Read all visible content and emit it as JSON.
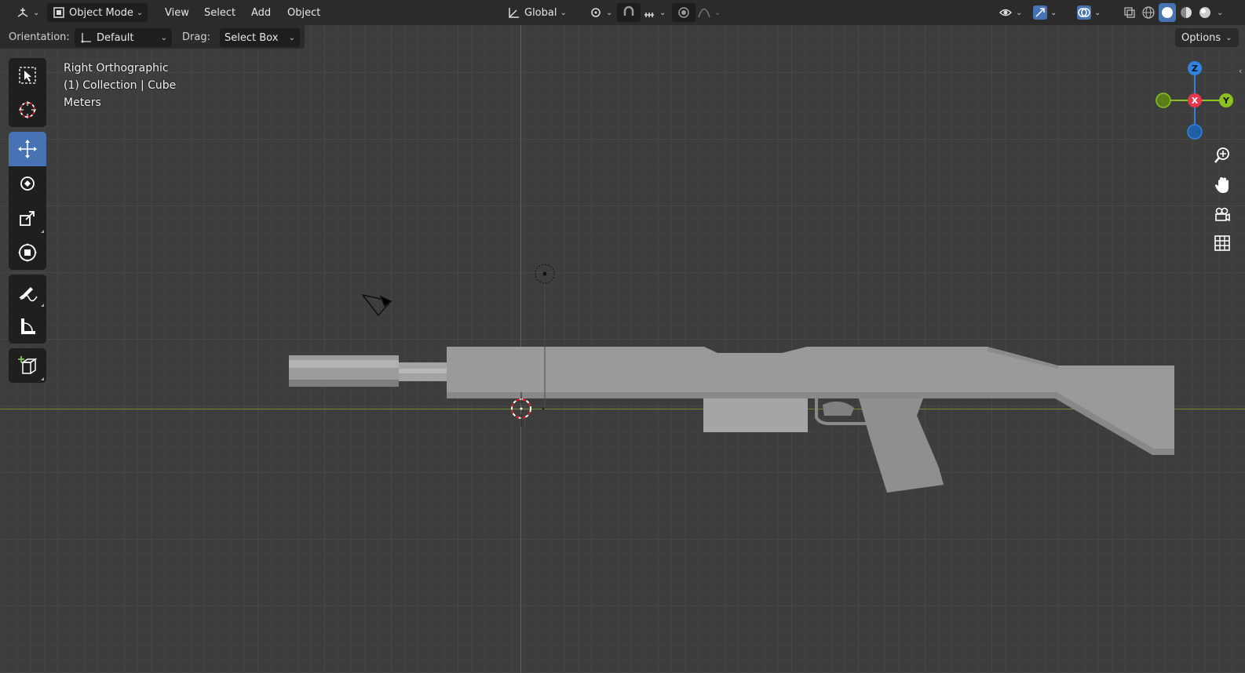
{
  "header": {
    "editor_type_icon": "3d-viewport-icon",
    "mode": "Object Mode",
    "menus": [
      "View",
      "Select",
      "Add",
      "Object"
    ],
    "transform_orientation": "Global",
    "right_icons": [
      "visibility-icon",
      "gizmo-icon",
      "overlay-icon",
      "xray-icon",
      "wireframe-shading-icon",
      "solid-shading-icon",
      "material-shading-icon",
      "rendered-shading-icon"
    ]
  },
  "tool_settings": {
    "orientation_label": "Orientation:",
    "orientation_value": "Default",
    "drag_label": "Drag:",
    "drag_value": "Select Box",
    "options_label": "Options"
  },
  "viewport_overlay": {
    "view_name": "Right Orthographic",
    "collection_line": "(1) Collection | Cube",
    "units": "Meters"
  },
  "gizmo": {
    "z_label": "Z",
    "x_label": "X",
    "y_label": "Y",
    "colors": {
      "x": "#e8364f",
      "y": "#8bc21f",
      "z": "#2f84e3"
    }
  },
  "toolbar": {
    "tools": [
      "select-box",
      "cursor",
      "move",
      "rotate",
      "scale",
      "transform",
      "annotate",
      "measure",
      "add-cube"
    ],
    "active": "move"
  },
  "colors": {
    "accent": "#4772b3",
    "viewport_bg": "#3d3d3d",
    "header_bg": "#2b2b2b",
    "model_gray": "#9a9a9a"
  }
}
